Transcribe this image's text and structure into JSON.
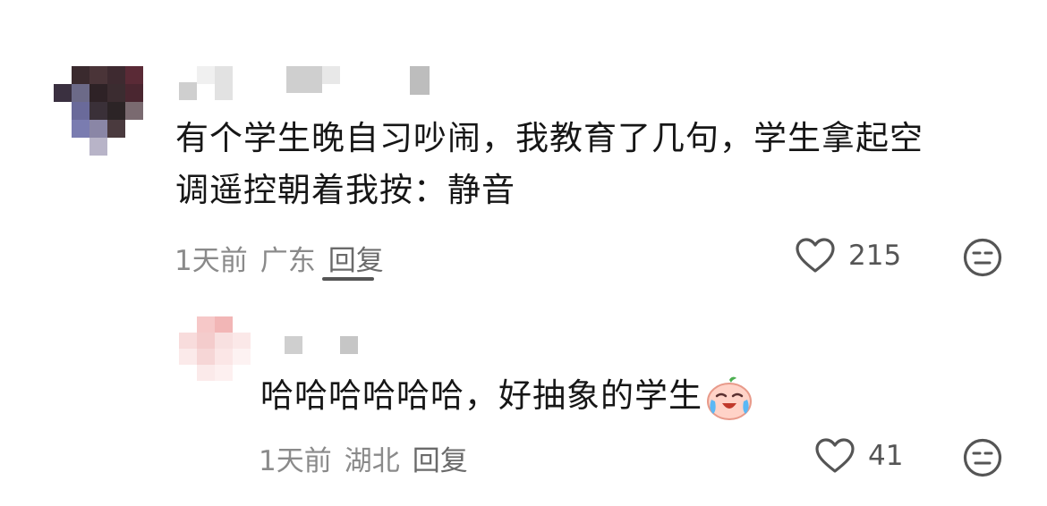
{
  "comments": [
    {
      "text": "有个学生晚自习吵闹，我教育了几句，学生拿起空调遥控朝着我按：静音",
      "text_line1": "有个学生晚自习吵闹，我教育了几句，学生拿起空",
      "text_line2": "调遥控朝着我按：静音",
      "time": "1天前",
      "location": "广东",
      "reply_label": "回复",
      "likes": "215"
    },
    {
      "text": "哈哈哈哈哈哈，好抽象的学生",
      "time": "1天前",
      "location": "湖北",
      "reply_label": "回复",
      "likes": "41",
      "emoji": "crying-laughing-emoji"
    }
  ],
  "icons": {
    "like": "heart-outline-icon",
    "dislike": "meh-face-icon"
  },
  "colors": {
    "text": "#161616",
    "meta": "#8a8a8a",
    "icon": "#555555"
  }
}
